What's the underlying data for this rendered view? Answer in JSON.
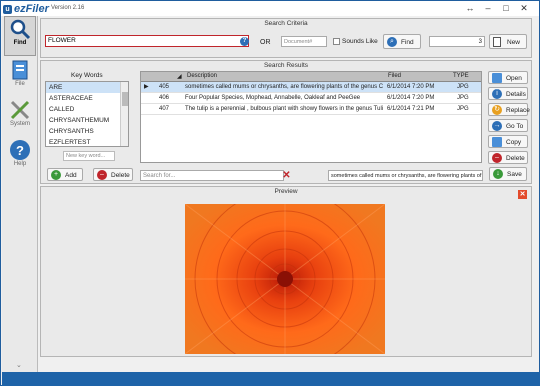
{
  "app": {
    "name": "ezFiler",
    "version": "Version 2.16"
  },
  "sidebar": {
    "items": [
      {
        "label": "Find",
        "icon": "magnifier-icon"
      },
      {
        "label": "File",
        "icon": "file-icon"
      },
      {
        "label": "System",
        "icon": "tools-icon"
      },
      {
        "label": "Help",
        "icon": "help-icon"
      }
    ]
  },
  "criteria": {
    "title": "Search Criteria",
    "search_value": "FLOWER",
    "or_label": "OR",
    "doc_placeholder": "Document#",
    "sounds_like": "Sounds Like",
    "find_label": "Find",
    "count": "3",
    "new_label": "New"
  },
  "results": {
    "title": "Search Results",
    "keywords_label": "Key Words",
    "keywords": [
      "ARE",
      "ASTERACEAE",
      "CALLED",
      "CHRYSANTHEMUM",
      "CHRYSANTHS",
      "EZFLERTEST"
    ],
    "new_keyword_placeholder": "New key word...",
    "add_label": "Add",
    "delete_label": "Delete",
    "columns": [
      "Description",
      "Filed",
      "TYPE"
    ],
    "rows": [
      {
        "id": "405",
        "description": "sometimes called mums or chrysanths, are flowering plants of the genus Chry...",
        "filed": "6/1/2014 7:20 PM",
        "type": "JPG"
      },
      {
        "id": "406",
        "description": "Four Popular Species, Mophead, Annabelle, Oakleaf and PeeGee",
        "filed": "6/1/2014 7:20 PM",
        "type": "JPG"
      },
      {
        "id": "407",
        "description": "The tulip is a perennial , bulbous plant with showy flowers in the genus Tulipa",
        "filed": "6/1/2014 7:21 PM",
        "type": "JPG"
      }
    ],
    "search_for_placeholder": "Search for...",
    "desc_field": "sometimes called mums or chrysanths, are flowering plants of",
    "actions": {
      "open": "Open",
      "details": "Details",
      "replace": "Replace",
      "goto": "Go To",
      "copy": "Copy",
      "delete": "Delete",
      "save": "Save"
    }
  },
  "preview": {
    "title": "Preview"
  },
  "colors": {
    "accent": "#1e63a8",
    "danger": "#c0252b",
    "selection": "#cde2f7"
  }
}
